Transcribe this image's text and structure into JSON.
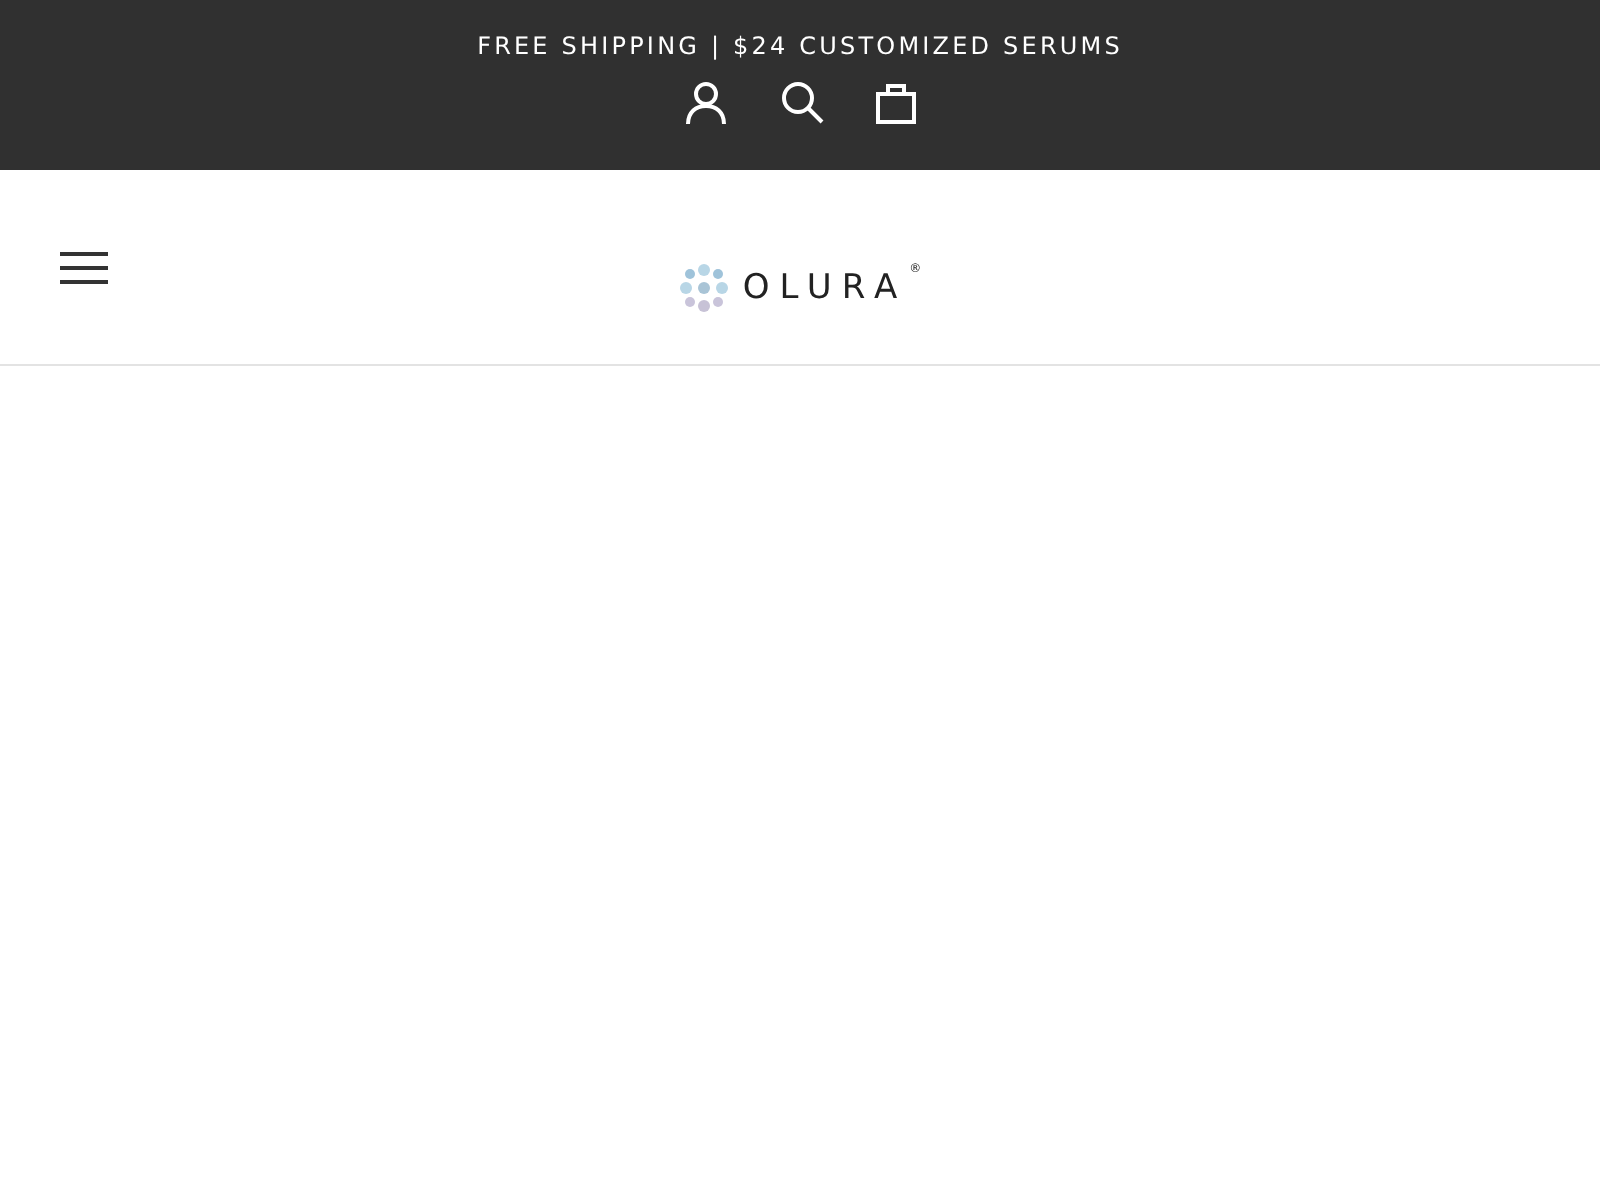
{
  "announcement": "FREE SHIPPING | $24 CUSTOMIZED SERUMS",
  "logo": {
    "text": "OLURA",
    "mark": "®"
  }
}
